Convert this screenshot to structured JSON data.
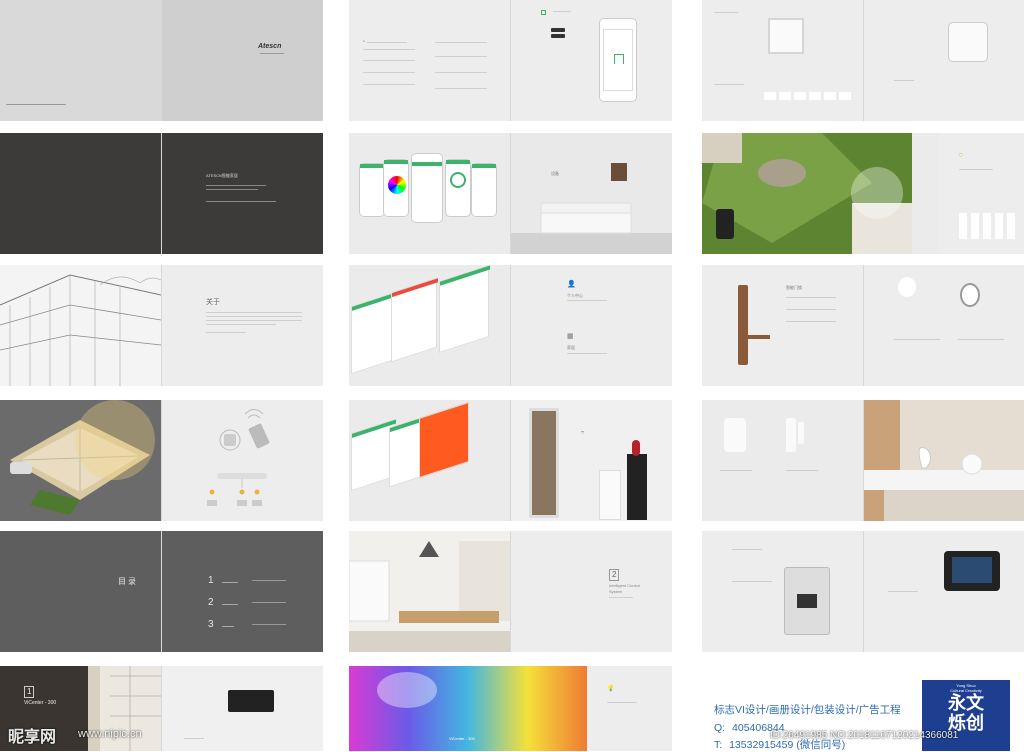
{
  "spreads": {
    "cover": {
      "brand": "Atescn"
    },
    "intro": {
      "heading": "ATESCN智能家居"
    },
    "about": {
      "heading": "关于"
    },
    "toc": {
      "heading": "目录",
      "items": [
        {
          "num": "1"
        },
        {
          "num": "2"
        },
        {
          "num": "3"
        }
      ]
    },
    "ch1": {
      "num": "1",
      "title": "ViCenter - 300"
    },
    "ch2": {
      "num": "2",
      "title_line1": "Intelligent Control",
      "title_line2": "System"
    },
    "ch2b": {
      "label": "ViCenter - 300"
    },
    "app": {
      "label1": "设备",
      "label2": "个人中心"
    },
    "app2": {
      "label": "家居"
    },
    "camera": {
      "label": "智能门锁"
    }
  },
  "footer": {
    "services": "标志VI设计/画册设计/包装设计/广告工程",
    "qq_label": "Q:",
    "qq": "405406844",
    "tel_label": "T:",
    "tel": "13532915459 (微信同号)",
    "logo_big": "永文",
    "logo_big2": "烁创",
    "logo_en1": "Yong Shuo",
    "logo_en2": "Cultural Creativity"
  },
  "watermark": {
    "site": "昵享网",
    "url": "www.nipic.cn",
    "id": "ID:26491985 NO:20181107120214366081"
  },
  "colors": {
    "green": "#3bb36a",
    "dark": "#3d3a3a",
    "gray": "#5e5e5e",
    "orange": "#ff5a1f"
  }
}
